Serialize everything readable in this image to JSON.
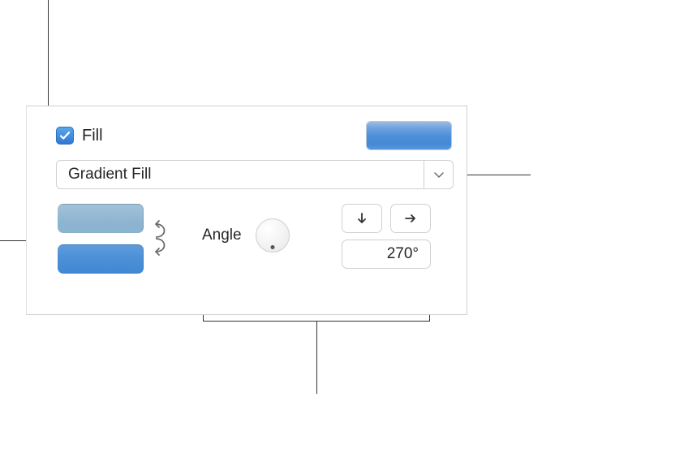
{
  "fill": {
    "checked": true,
    "label": "Fill",
    "type_label": "Gradient Fill",
    "preview_gradient": {
      "from": "#9cbbe0",
      "to": "#448ad6"
    },
    "color_stops": [
      {
        "color": "#8db5d1"
      },
      {
        "color": "#4b8fd7"
      }
    ],
    "angle": {
      "label": "Angle",
      "value": "270°",
      "dial_degrees": 270
    }
  }
}
